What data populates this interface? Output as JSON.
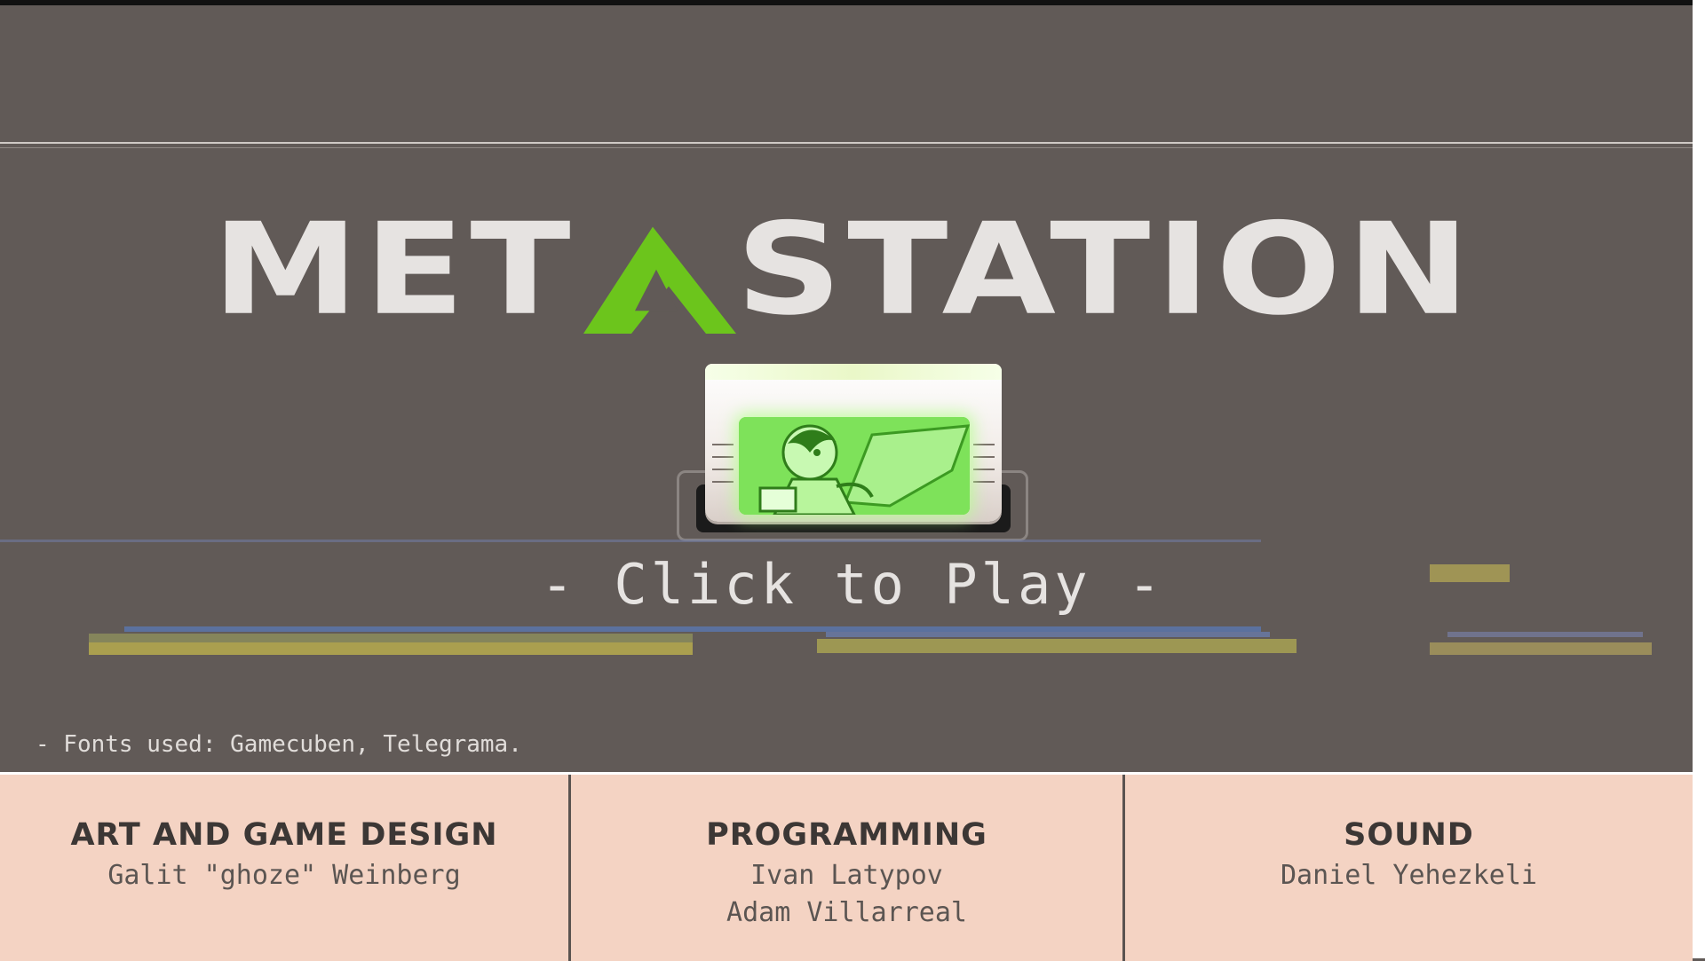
{
  "title": {
    "before_a": "MET",
    "after_a": "STATION",
    "accent_color": "#6cc51c"
  },
  "cartridge": {
    "label": "cartridge-play-icon"
  },
  "play": {
    "label": "- Click to Play -"
  },
  "fonts_note": "- Fonts used: Gamecuben, Telegrama.",
  "credits": [
    {
      "heading": "ART AND GAME DESIGN",
      "names": [
        "Galit \"ghoze\" Weinberg"
      ]
    },
    {
      "heading": "PROGRAMMING",
      "names": [
        "Ivan Latypov",
        "Adam Villarreal"
      ]
    },
    {
      "heading": "SOUND",
      "names": [
        "Daniel Yehezkeli"
      ]
    }
  ]
}
